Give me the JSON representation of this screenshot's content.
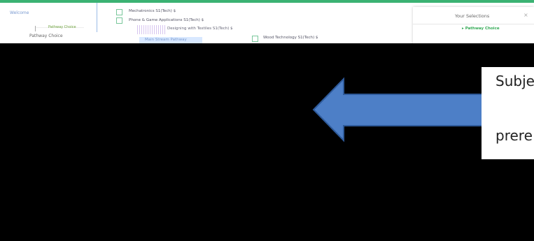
{
  "nav": {
    "welcome": "Welcome",
    "pathway_small": "Pathway Choice",
    "pathway_side": "Pathway Choice"
  },
  "courses": [
    {
      "label": "Mechatronics S1(Tech) $"
    },
    {
      "label": "Phone & Game Applications S1(Tech) $"
    },
    {
      "label": "Designing with Textiles S1(Tech) $"
    },
    {
      "label": "Wood Technology S1(Tech) $"
    }
  ],
  "main_stream": "Main Stream Pathway",
  "selections": {
    "title": "Your Selections",
    "close": "×",
    "item": "Pathway Choice"
  },
  "callout": {
    "line1": "Subje",
    "line2": "prere"
  },
  "colors": {
    "accent": "#3bb273",
    "arrow_fill": "#4d7fc7",
    "arrow_stroke": "#2e5a9a"
  }
}
